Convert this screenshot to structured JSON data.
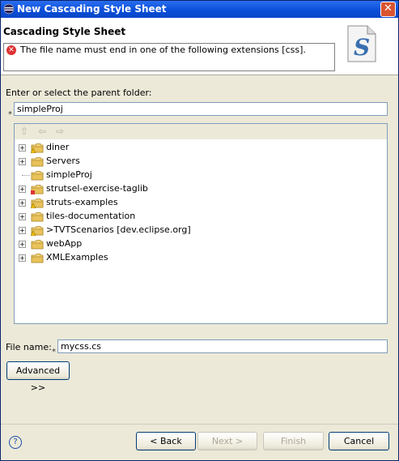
{
  "window": {
    "title": "New Cascading Style Sheet",
    "close_glyph": "✕"
  },
  "banner": {
    "heading": "Cascading Style Sheet",
    "error_message": "The file name must end in one of the following extensions [css].",
    "wizard_icon": "css-file-wizard-icon"
  },
  "parent_folder": {
    "label": "Enter or select the parent folder:",
    "required_marker": "*",
    "value": "simpleProj"
  },
  "tree": {
    "toolbar_icons": [
      "home-icon",
      "back-icon",
      "forward-icon"
    ],
    "items": [
      {
        "label": "diner",
        "expandable": true,
        "overlay": "warning"
      },
      {
        "label": "Servers",
        "expandable": true,
        "overlay": "none"
      },
      {
        "label": "simpleProj",
        "expandable": false,
        "overlay": "none"
      },
      {
        "label": "strutsel-exercise-taglib",
        "expandable": true,
        "overlay": "error"
      },
      {
        "label": "struts-examples",
        "expandable": true,
        "overlay": "warning"
      },
      {
        "label": "tiles-documentation",
        "expandable": true,
        "overlay": "none"
      },
      {
        "label": ">TVTScenarios  [dev.eclipse.org]",
        "expandable": true,
        "overlay": "warning"
      },
      {
        "label": "webApp",
        "expandable": true,
        "overlay": "none"
      },
      {
        "label": "XMLExamples",
        "expandable": true,
        "overlay": "none"
      }
    ]
  },
  "file_name": {
    "label": "File name:",
    "required_marker": "*",
    "value": "mycss.cs"
  },
  "buttons": {
    "advanced": "Advanced >>",
    "back": "< Back",
    "next": "Next >",
    "finish": "Finish",
    "cancel": "Cancel",
    "help": "?"
  }
}
